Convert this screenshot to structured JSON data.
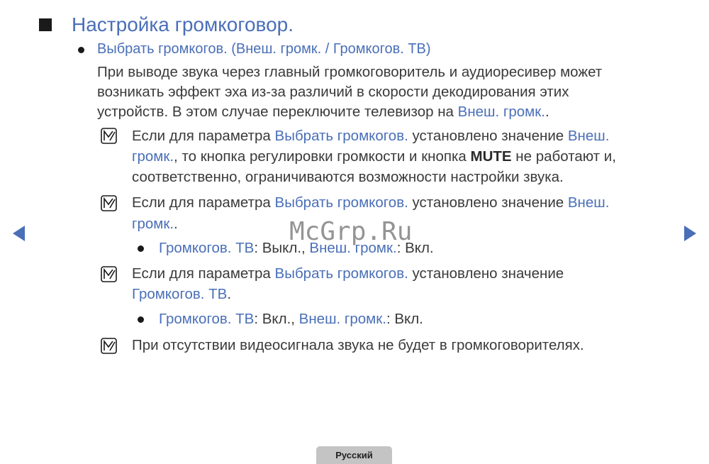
{
  "heading": "Настройка громкоговор.",
  "subheading": "Выбрать громкогов. (Внеш. громк. / Громкогов. ТВ)",
  "intro": {
    "l1": "При выводе звука через главный громкоговоритель и аудиоресивер может",
    "l2": "возникать эффект эха из-за различий в скорости декодирования этих",
    "l3a": "устройств. В этом случае переключите телевизор на ",
    "l3b": "Внеш. громк.",
    "l3c": "."
  },
  "note1": {
    "a": "Если для параметра ",
    "b": "Выбрать громкогов.",
    "c": " установлено значение ",
    "d": "Внеш.",
    "e": "громк.",
    "f": ", то кнопка регулировки громкости и кнопка ",
    "g": "MUTE",
    "h": " не работают и,",
    "i": "соответственно, ограничиваются возможности настройки звука."
  },
  "note2": {
    "a": "Если для параметра ",
    "b": "Выбрать громкогов.",
    "c": " установлено значение ",
    "d": "Внеш.",
    "e": "громк.",
    "f": "."
  },
  "bullet2": {
    "a": "Громкогов. ТВ",
    "b": ": Выкл., ",
    "c": "Внеш. громк.",
    "d": ": Вкл."
  },
  "note3": {
    "a": "Если для параметра ",
    "b": "Выбрать громкогов.",
    "c": " установлено значение",
    "d": "Громкогов. ТВ",
    "e": "."
  },
  "bullet3": {
    "a": "Громкогов. ТВ",
    "b": ": Вкл., ",
    "c": "Внеш. громк.",
    "d": ": Вкл."
  },
  "note4": "При отсутствии видеосигнала звука не будет в громкоговорителях.",
  "watermark": "McGrp.Ru",
  "language_tab": "Русский",
  "colors": {
    "highlight": "#4a6fb8",
    "text": "#3a3a3a",
    "tab": "#c4c4c4"
  }
}
